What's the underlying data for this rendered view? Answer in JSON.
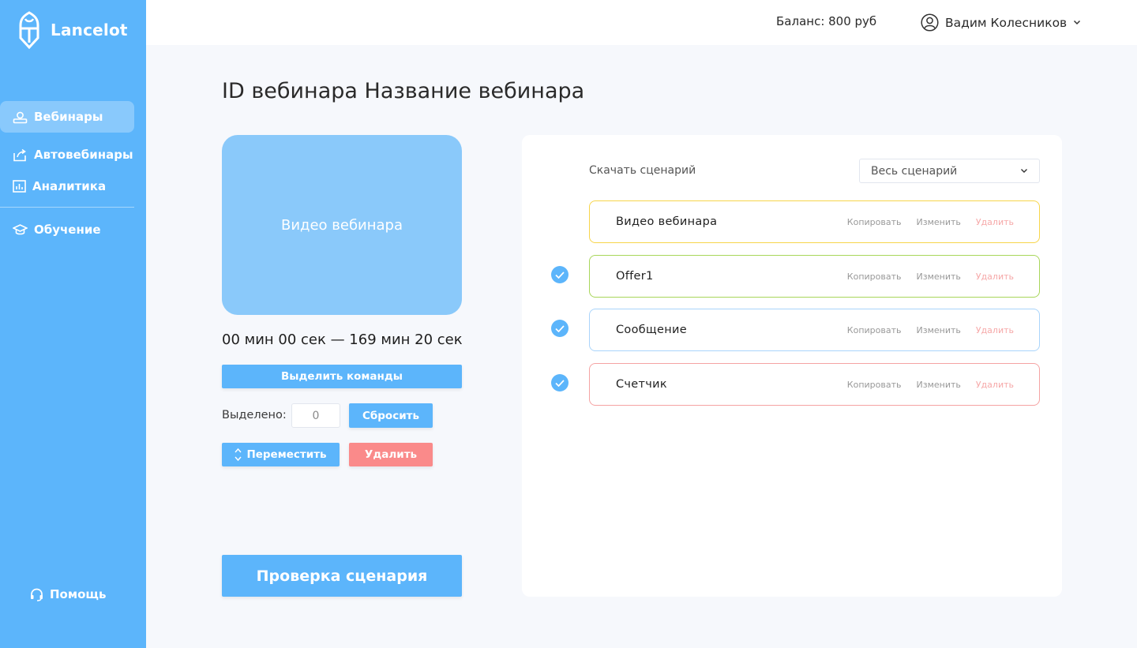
{
  "app": {
    "logo_text": "Lancelot"
  },
  "sidebar": {
    "items": [
      {
        "label": "Вебинары",
        "icon": "webinar-icon",
        "active": true
      },
      {
        "label": "Автовебинары",
        "icon": "autowebinar-icon",
        "active": false
      },
      {
        "label": "Аналитика",
        "icon": "analytics-icon",
        "active": false
      },
      {
        "label": "Обучение",
        "icon": "graduation-cap-icon",
        "active": false
      }
    ],
    "help_label": "Помощь"
  },
  "header": {
    "balance": "Баланс: 800 руб",
    "user_name": "Вадим Колесников"
  },
  "page": {
    "title": "ID вебинара Название вебинара",
    "video_label": "Видео вебинара",
    "time_range": "00 мин 00 сек — 169 мин 20 сек",
    "select_commands_label": "Выделить команды",
    "selected_label": "Выделено:",
    "selected_count": "0",
    "reset_label": "Сбросить",
    "move_label": "Переместить",
    "delete_label": "Удалить",
    "check_scenario_label": "Проверка сценария"
  },
  "panel": {
    "download_label": "Скачать сценарий",
    "scenario_filter": "Весь сценарий",
    "action_copy": "Копировать",
    "action_edit": "Изменить",
    "action_delete": "Удалить",
    "cards": [
      {
        "title": "Видео вебинара",
        "border_color": "#f7d54a",
        "checked": false
      },
      {
        "title": "Offer1",
        "border_color": "#a8d65a",
        "checked": true
      },
      {
        "title": "Сообщение",
        "border_color": "#a9d4fb",
        "checked": true
      },
      {
        "title": "Счетчик",
        "border_color": "#f5a3a3",
        "checked": true
      }
    ]
  },
  "colors": {
    "accent": "#5cb5fb",
    "danger": "#fa8a8a",
    "video_placeholder": "#8ac9fa",
    "background": "#f6f8fc"
  }
}
